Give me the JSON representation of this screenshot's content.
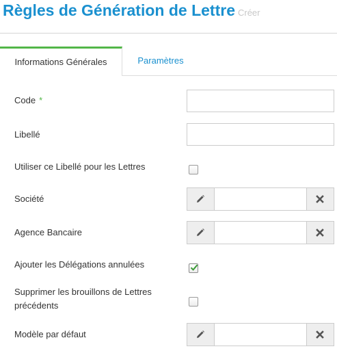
{
  "header": {
    "title": "Règles de Génération de Lettre",
    "subtitle": "Créer"
  },
  "tabs": [
    {
      "label": "Informations Générales",
      "active": true
    },
    {
      "label": "Paramètres",
      "active": false
    }
  ],
  "form": {
    "code": {
      "label": "Code",
      "required_mark": "*",
      "value": ""
    },
    "libelle": {
      "label": "Libellé",
      "value": ""
    },
    "utiliser_libelle": {
      "label": "Utiliser ce Libellé pour les Lettres",
      "checked": false
    },
    "societe": {
      "label": "Société",
      "value": ""
    },
    "agence_bancaire": {
      "label": "Agence Bancaire",
      "value": ""
    },
    "ajouter_delegations": {
      "label": "Ajouter les Délégations annulées",
      "checked": true
    },
    "supprimer_brouillons": {
      "label": "Supprimer les brouillons de Lettres précédents",
      "checked": false
    },
    "modele_defaut": {
      "label": "Modèle par défaut",
      "value": ""
    }
  },
  "icons": {
    "edit": "pencil-icon",
    "clear": "close-icon",
    "check": "checkmark-icon"
  },
  "colors": {
    "title": "#1a90cf",
    "tab_active_border": "#52b648",
    "tab_link": "#1a90cf",
    "required": "#52b648",
    "check": "#3a9a36"
  }
}
